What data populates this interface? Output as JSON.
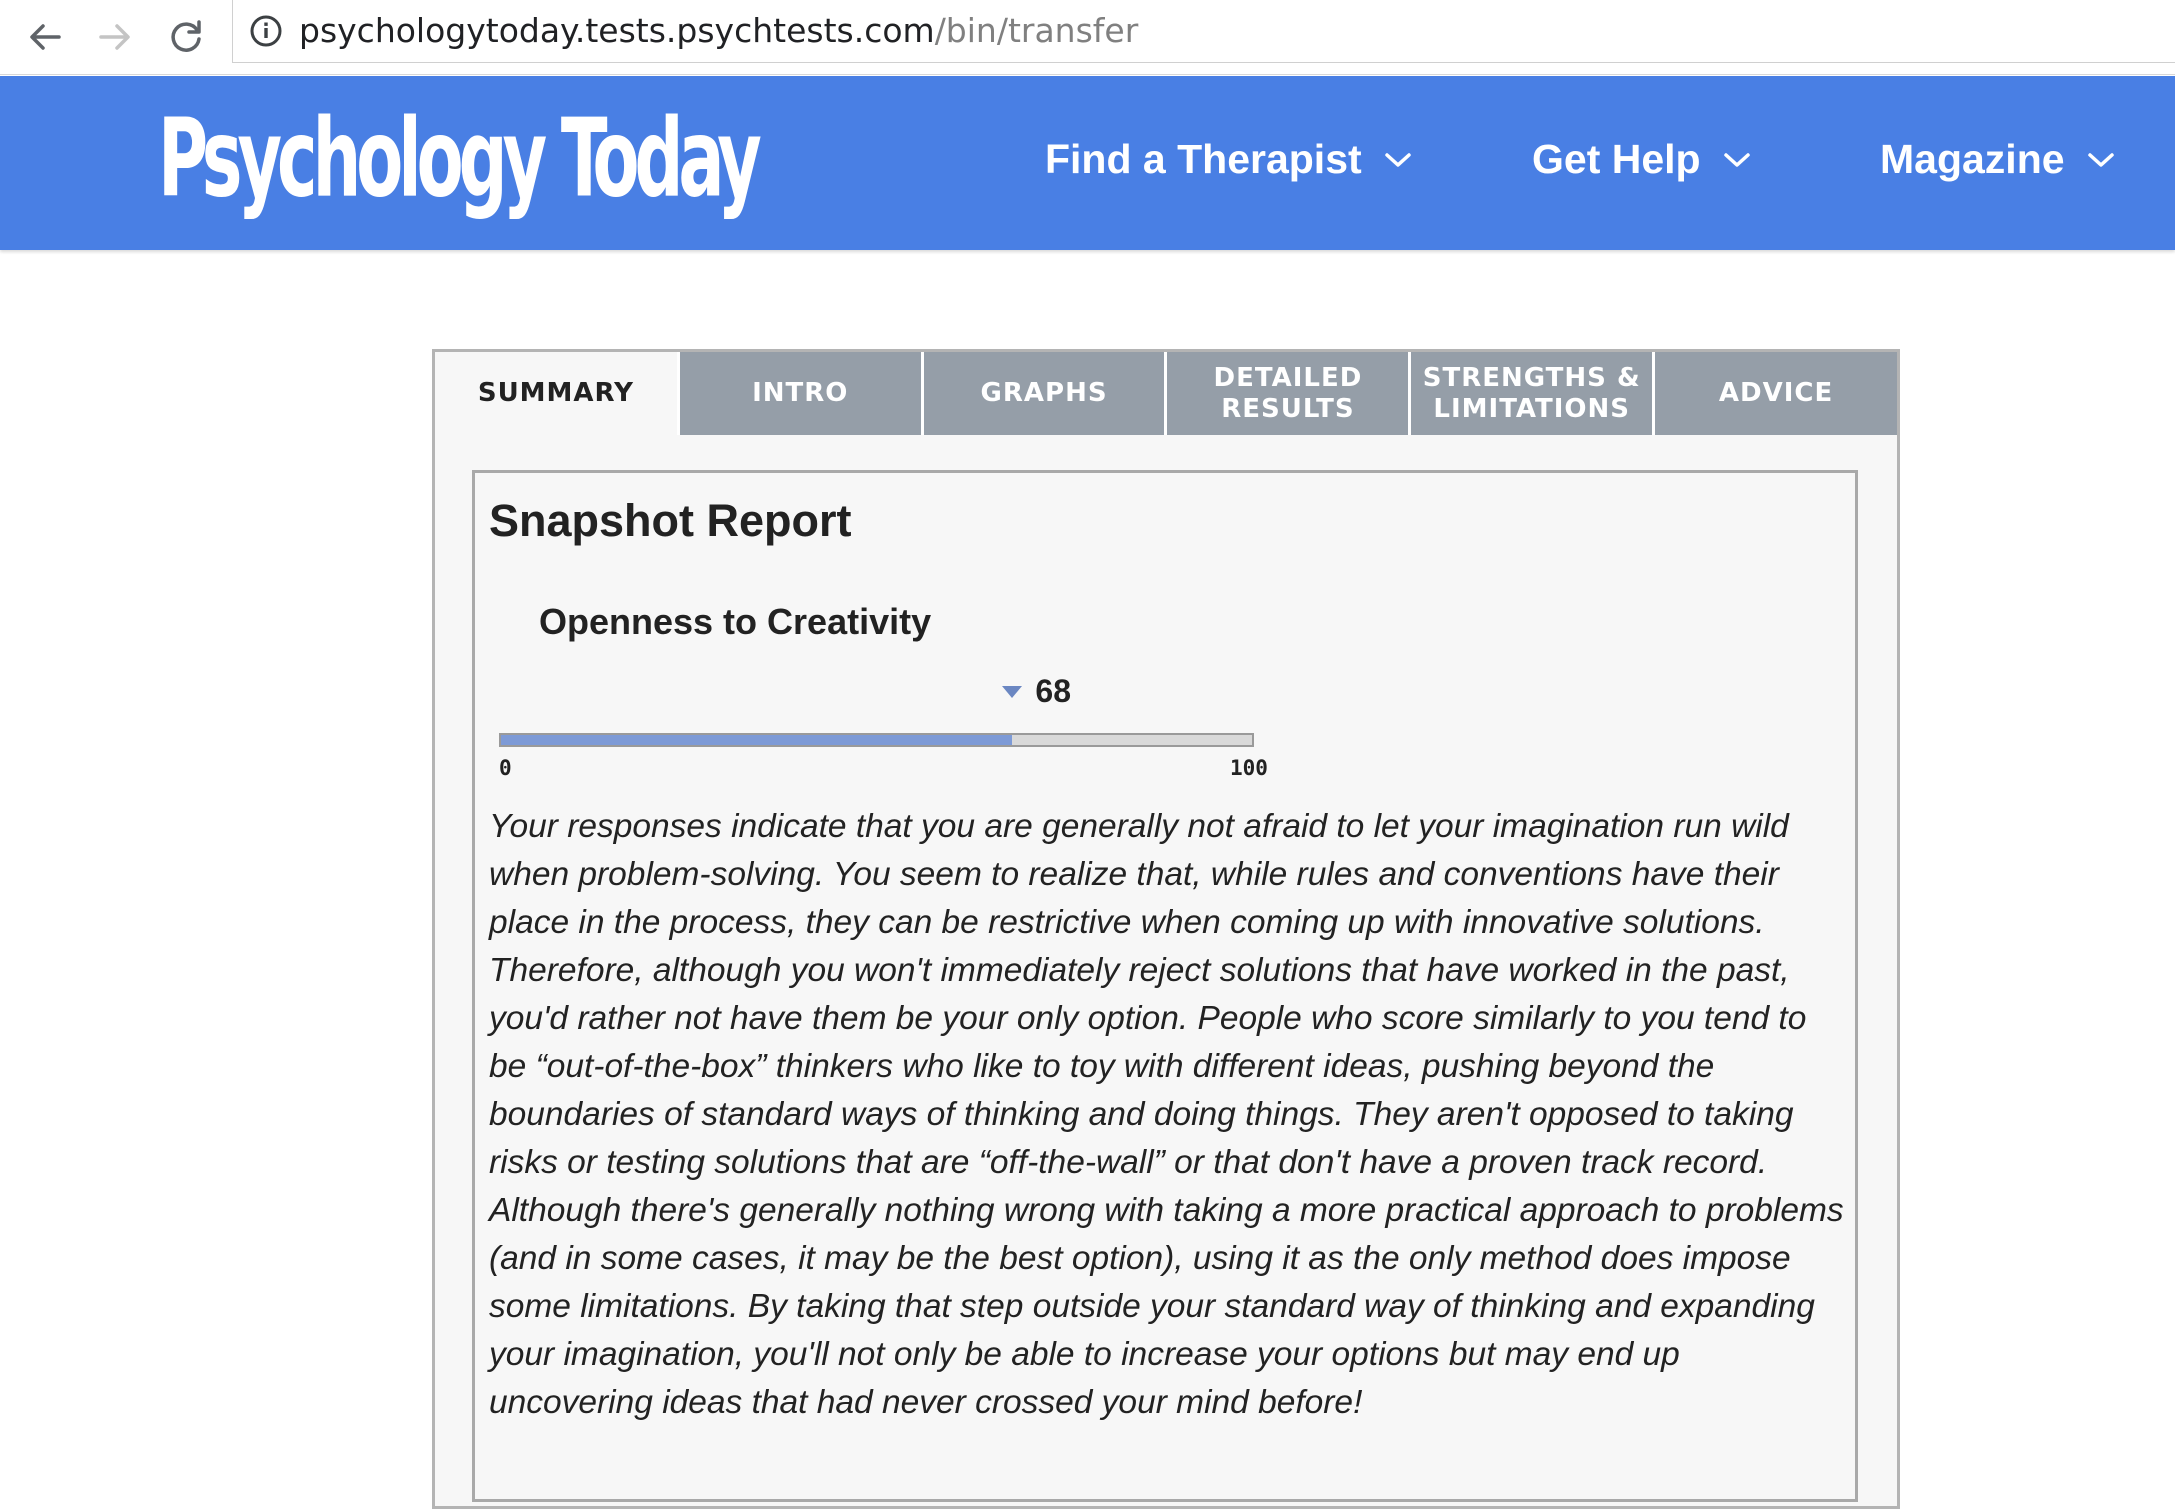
{
  "browser": {
    "url_domain": "psychologytoday.tests.psychtests.com",
    "url_path": "/bin/transfer"
  },
  "header": {
    "logo": "Psychology Today",
    "menu": [
      {
        "label": "Find a Therapist"
      },
      {
        "label": "Get Help"
      },
      {
        "label": "Magazine"
      }
    ],
    "color": "#497fe4"
  },
  "tabs": [
    {
      "label": "SUMMARY",
      "active": true
    },
    {
      "label": "INTRO"
    },
    {
      "label": "GRAPHS"
    },
    {
      "label": "DETAILED\nRESULTS"
    },
    {
      "label": "STRENGTHS &\nLIMITATIONS"
    },
    {
      "label": "ADVICE"
    }
  ],
  "report": {
    "title": "Snapshot Report",
    "scale_name": "Openness to Creativity",
    "score": 68,
    "scale_min": 0,
    "scale_max": 100,
    "fill_color": "#7d9ad6",
    "text": "Your responses indicate that you are generally not afraid to let your imagination run wild when problem-solving. You seem to realize that, while rules and conventions have their place in the process, they can be restrictive when coming up with innovative solutions. Therefore, although you won't immediately reject solutions that have worked in the past, you'd rather not have them be your only option. People who score similarly to you tend to be “out-of-the-box” thinkers who like to toy with different ideas, pushing beyond the boundaries of standard ways of thinking and doing things. They aren't opposed to taking risks or testing solutions that are “off-the-wall” or that don't have a proven track record. Although there's generally nothing wrong with taking a more practical approach to problems (and in some cases, it may be the best option), using it as the only method does impose some limitations. By taking that step outside your standard way of thinking and expanding your imagination, you'll not only be able to increase your options but may end up uncovering ideas that had never crossed your mind before!"
  }
}
